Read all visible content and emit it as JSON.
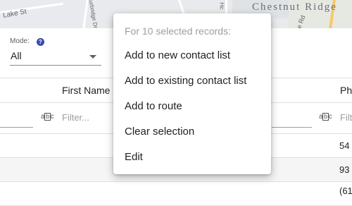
{
  "map": {
    "street_label": "Lake St",
    "road_label_1": "Sturbridge Dr",
    "road_label_2": "Hc",
    "road_label_3": "e Rd",
    "area_label": "Chestnut Ridge"
  },
  "mode": {
    "label": "Mode:",
    "help_icon": "question-circle-icon",
    "value": "All"
  },
  "grid": {
    "columns": [
      {
        "header": ""
      },
      {
        "header": "First Name",
        "filter_placeholder": "Filter...",
        "filter_icon": "text-filter-icon"
      },
      {
        "header": ""
      },
      {
        "header": "Ph",
        "filter_placeholder": "Filt",
        "filter_icon": "text-filter-icon"
      }
    ],
    "rows": [
      {
        "phone": "54"
      },
      {
        "phone": "93"
      },
      {
        "phone": "(61"
      }
    ]
  },
  "context_menu": {
    "header": "For 10 selected records:",
    "items": [
      {
        "label": "Add to new contact list"
      },
      {
        "label": "Add to existing contact list"
      },
      {
        "label": "Add to route"
      },
      {
        "label": "Clear selection"
      },
      {
        "label": "Edit"
      }
    ]
  },
  "colors": {
    "accent": "#3949ab",
    "menu_header": "#9e9e9e",
    "map_bg": "#e8eaed",
    "highway": "#f6c96b"
  }
}
